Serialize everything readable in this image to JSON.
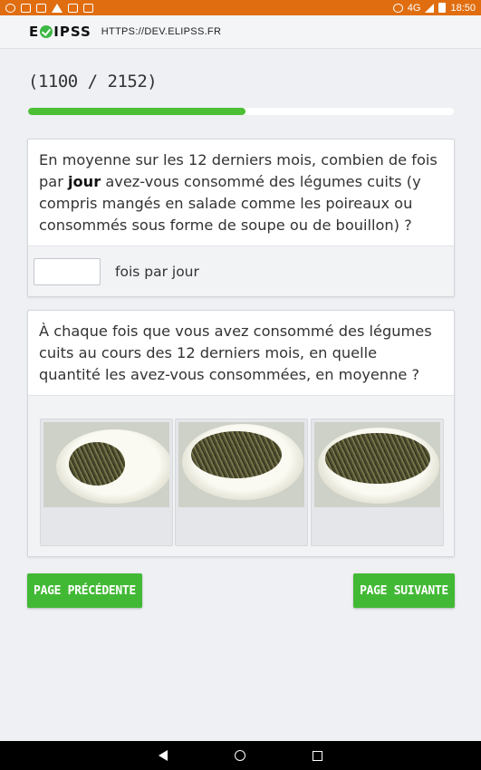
{
  "status_bar": {
    "network": "4G",
    "time": "18:50"
  },
  "app_bar": {
    "logo_left": "E",
    "logo_right": "IPSS",
    "url": "HTTPS://DEV.ELIPSS.FR"
  },
  "progress": {
    "label": "(1100 / 2152)",
    "current": 1100,
    "total": 2152
  },
  "question1": {
    "text_before": "En moyenne sur les 12 derniers mois, combien de fois par ",
    "text_bold": "jour",
    "text_after": " avez-vous consommé des légumes cuits (y compris mangés en salade comme les poireaux ou consommés sous forme de soupe ou de bouillon) ?",
    "input_value": "",
    "unit": "fois par jour"
  },
  "question2": {
    "text": "À chaque fois que vous avez consommé des légumes cuits au cours des 12 derniers mois, en quelle quantité les avez-vous consommées, en moyenne ?",
    "options": [
      {
        "portion": "small"
      },
      {
        "portion": "medium"
      },
      {
        "portion": "large"
      }
    ]
  },
  "buttons": {
    "previous": "PAGE PRÉCÉDENTE",
    "next": "PAGE SUIVANTE"
  },
  "colors": {
    "status_bar": "#e06e10",
    "accent_green": "#42b935",
    "progress_fill": "#4cbf35"
  }
}
